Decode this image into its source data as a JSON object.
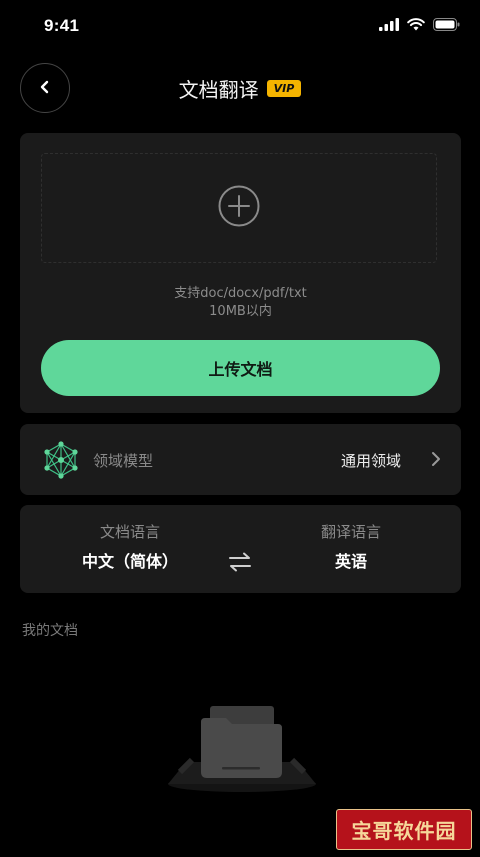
{
  "status_bar": {
    "time": "9:41",
    "icons": [
      "cellular-signal-icon",
      "wifi-icon",
      "battery-icon"
    ]
  },
  "header": {
    "title": "文档翻译",
    "badge": "VIP",
    "back_icon": "chevron-left-icon"
  },
  "upload": {
    "add_icon": "plus-circle-icon",
    "hint_line1": "支持doc/docx/pdf/txt",
    "hint_line2": "10MB以内",
    "button_label": "上传文档"
  },
  "domain_model": {
    "icon": "neural-network-icon",
    "label": "领域模型",
    "value": "通用领域",
    "chevron_icon": "chevron-right-icon"
  },
  "languages": {
    "source_label": "文档语言",
    "source_value": "中文（简体）",
    "swap_icon": "swap-arrows-icon",
    "target_label": "翻译语言",
    "target_value": "英语"
  },
  "my_documents": {
    "label": "我的文档",
    "empty_icon": "empty-folder-icon"
  },
  "watermark": {
    "text": "宝哥软件园"
  },
  "colors": {
    "background": "#000000",
    "card": "#1b1b1b",
    "accent_green": "#5fd79a",
    "vip_gold": "#f5b400",
    "watermark_red": "#b5121b"
  }
}
